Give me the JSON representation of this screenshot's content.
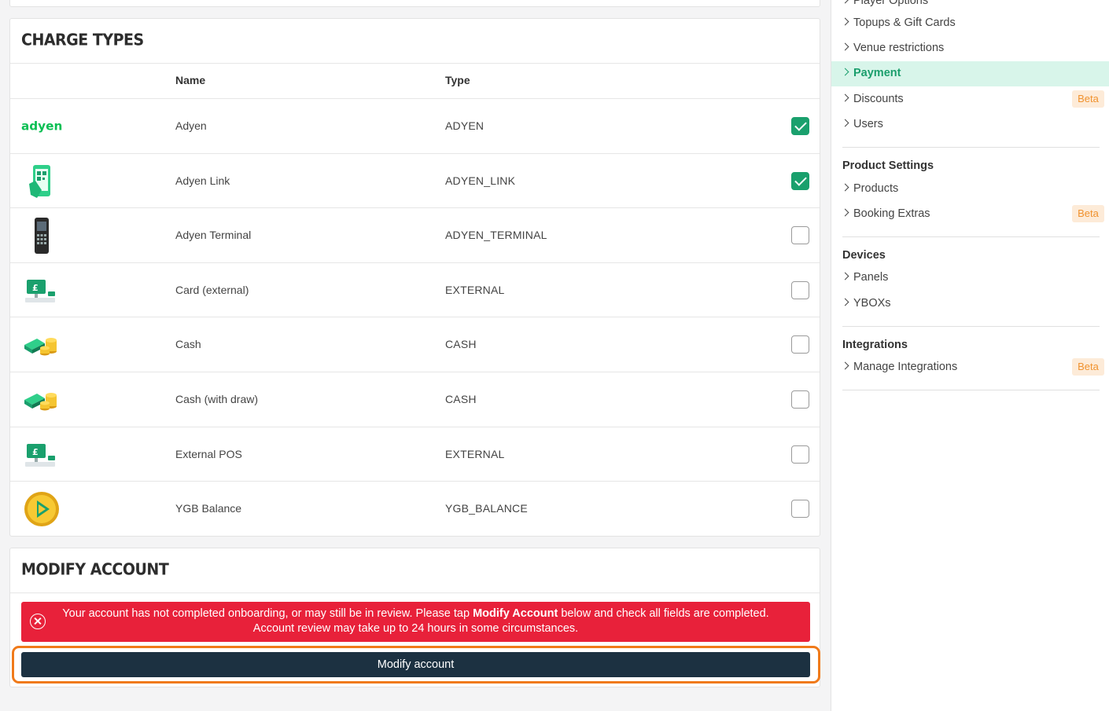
{
  "charge_types": {
    "title": "CHARGE TYPES",
    "columns": {
      "name": "Name",
      "type": "Type"
    },
    "rows": [
      {
        "icon": "adyen-logo-icon",
        "name": "Adyen",
        "type": "ADYEN",
        "enabled": true
      },
      {
        "icon": "qr-phone-icon",
        "name": "Adyen Link",
        "type": "ADYEN_LINK",
        "enabled": true
      },
      {
        "icon": "card-terminal-icon",
        "name": "Adyen Terminal",
        "type": "ADYEN_TERMINAL",
        "enabled": false
      },
      {
        "icon": "pos-screen-icon",
        "name": "Card (external)",
        "type": "EXTERNAL",
        "enabled": false
      },
      {
        "icon": "cash-coins-icon",
        "name": "Cash",
        "type": "CASH",
        "enabled": false
      },
      {
        "icon": "cash-coins-icon",
        "name": "Cash (with draw)",
        "type": "CASH",
        "enabled": false
      },
      {
        "icon": "pos-screen-icon",
        "name": "External POS",
        "type": "EXTERNAL",
        "enabled": false
      },
      {
        "icon": "ygb-coin-icon",
        "name": "YGB Balance",
        "type": "YGB_BALANCE",
        "enabled": false
      }
    ]
  },
  "modify_account": {
    "title": "MODIFY ACCOUNT",
    "alert_line1_pre": "Your account has not completed onboarding, or may still be in review. Please tap ",
    "alert_line1_bold": "Modify Account",
    "alert_line1_post": " below and check all fields are completed.",
    "alert_line2": "Account review may take up to 24 hours in some circumstances.",
    "button_label": "Modify account"
  },
  "sidebar": {
    "top_cut_item": "Player Options",
    "items_group1": [
      {
        "label": "Topups & Gift Cards"
      },
      {
        "label": "Venue restrictions"
      },
      {
        "label": "Payment",
        "active": true
      },
      {
        "label": "Discounts",
        "badge": "Beta"
      },
      {
        "label": "Users"
      }
    ],
    "product_settings": {
      "heading": "Product Settings",
      "items": [
        {
          "label": "Products"
        },
        {
          "label": "Booking Extras",
          "badge": "Beta"
        }
      ]
    },
    "devices": {
      "heading": "Devices",
      "items": [
        {
          "label": "Panels"
        },
        {
          "label": "YBOXs"
        }
      ]
    },
    "integrations": {
      "heading": "Integrations",
      "items": [
        {
          "label": "Manage Integrations",
          "badge": "Beta"
        }
      ]
    }
  },
  "colors": {
    "accent_green": "#1aa06d",
    "alert_red": "#e8213a",
    "button_navy": "#1c3141",
    "highlight_orange": "#f07a1a",
    "beta_orange": "#f0922e"
  }
}
